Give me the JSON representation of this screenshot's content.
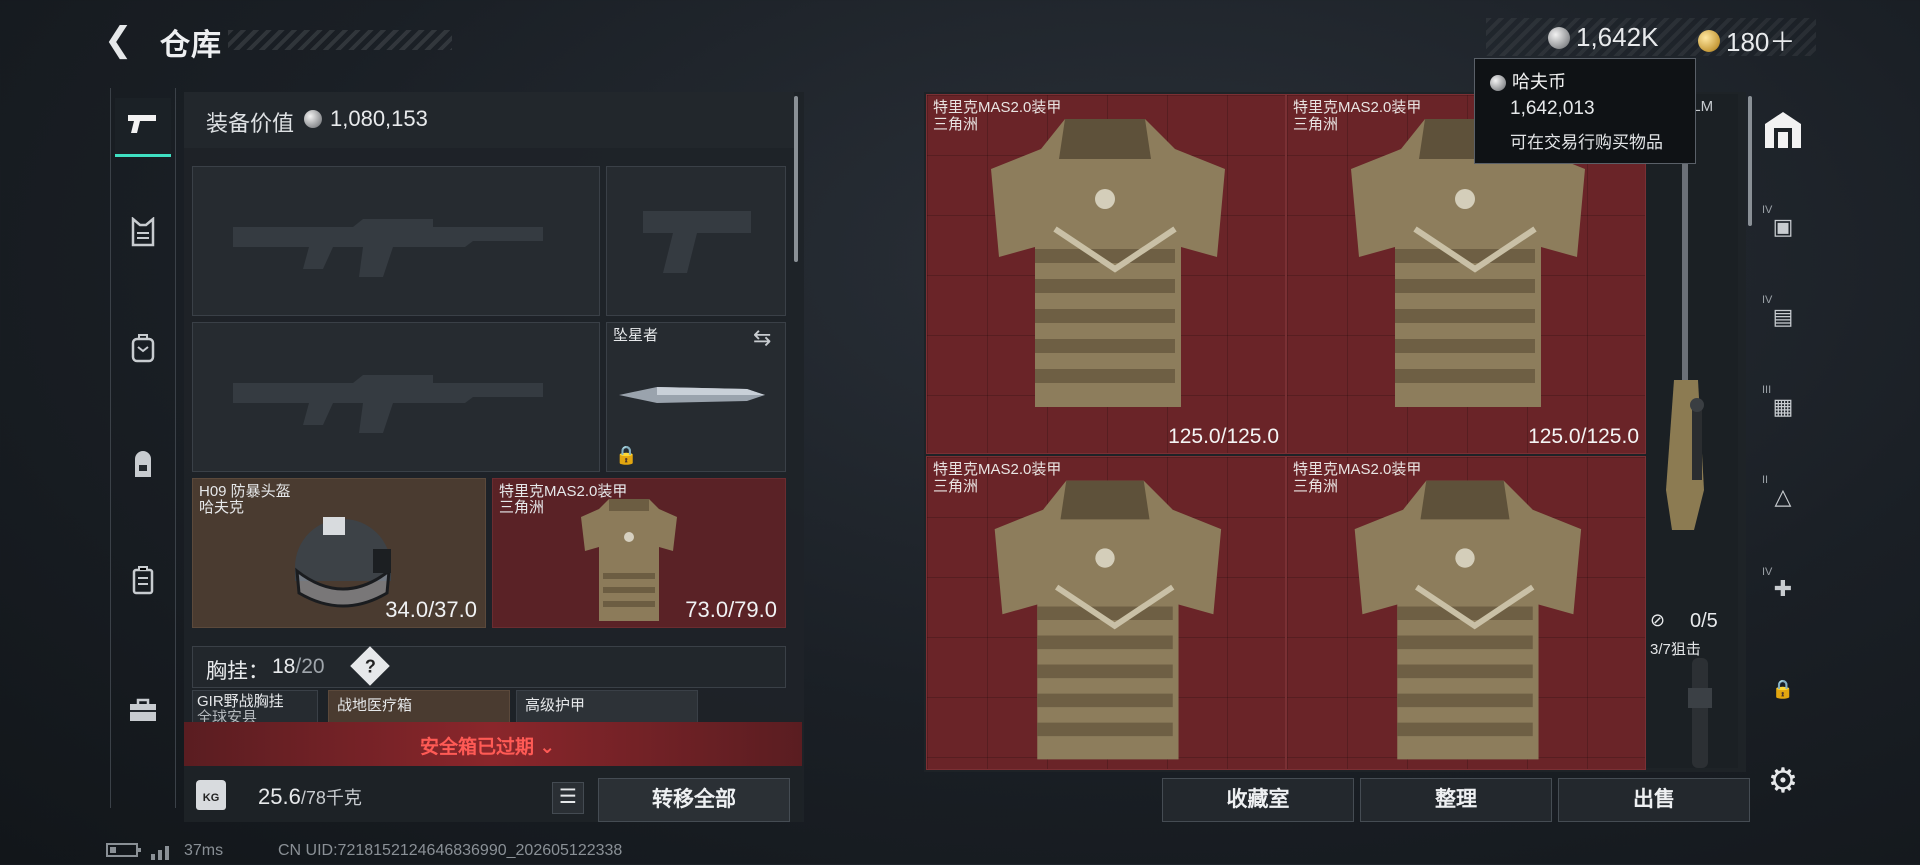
{
  "header": {
    "title": "仓库",
    "currency": {
      "haf_coin": "1,642K",
      "premium": "180＋"
    }
  },
  "tooltip": {
    "title": "哈夫币",
    "value": "1,642,013",
    "desc": "可在交易行购买物品"
  },
  "left_rail": [
    "pistol-icon",
    "vest-icon",
    "backpack-icon",
    "bag-icon",
    "case-icon",
    "toolbox-icon"
  ],
  "equipment": {
    "value_label": "装备价值",
    "value": "1,080,153",
    "melee": {
      "name": "坠星者"
    },
    "helmet": {
      "name": "H09 防暴头盔",
      "brand": "哈夫克",
      "condition": "34.0/37.0"
    },
    "armor": {
      "name": "特里克MAS2.0装甲",
      "brand": "三角洲",
      "condition": "73.0/79.0"
    },
    "rig_label": "胸挂：",
    "rig_count": "18",
    "rig_max": "/20",
    "rig_help": "?",
    "items": [
      {
        "name": "GIR野战胸挂",
        "sub": "全球安县"
      },
      {
        "name": "战地医疗箱"
      },
      {
        "name": "高级护甲"
      }
    ],
    "secure_label": "安全箱已过期",
    "weight": "25.6",
    "weight_max": "/78千克",
    "weight_icon_text": "KG",
    "transfer_label": "转移全部"
  },
  "grid": {
    "cells": [
      {
        "name": "特里克MAS2.0装甲",
        "brand": "三角洲",
        "condition": "125.0/125.0"
      },
      {
        "name": "特里克MAS2.0装甲",
        "brand": "三角洲",
        "condition": "125.0/125.0"
      },
      {
        "name": "特里克MAS2.0装甲",
        "brand": "三角洲",
        "condition": ""
      },
      {
        "name": "特里克MAS2.0装甲",
        "brand": "三角洲",
        "condition": ""
      }
    ],
    "side_label": "AWM LM",
    "count": "0/5",
    "scope_label": "3/7狙击"
  },
  "bottom_buttons": {
    "collection": "收藏室",
    "sort": "整理",
    "sell": "出售"
  },
  "right_rail": [
    {
      "icon": "warehouse-icon",
      "tier": ""
    },
    {
      "icon": "storage-iv-icon",
      "tier": "IV"
    },
    {
      "icon": "storage-iv-2-icon",
      "tier": "IV"
    },
    {
      "icon": "storage-iii-icon",
      "tier": "III"
    },
    {
      "icon": "storage-ii-icon",
      "tier": "II"
    },
    {
      "icon": "storage-iv-3-icon",
      "tier": "IV"
    },
    {
      "icon": "lock-icon",
      "tier": ""
    },
    {
      "icon": "gear-icon",
      "tier": ""
    }
  ],
  "status": {
    "ping": "37ms",
    "uid": "CN UID:7218152124646836990_202605122338"
  }
}
